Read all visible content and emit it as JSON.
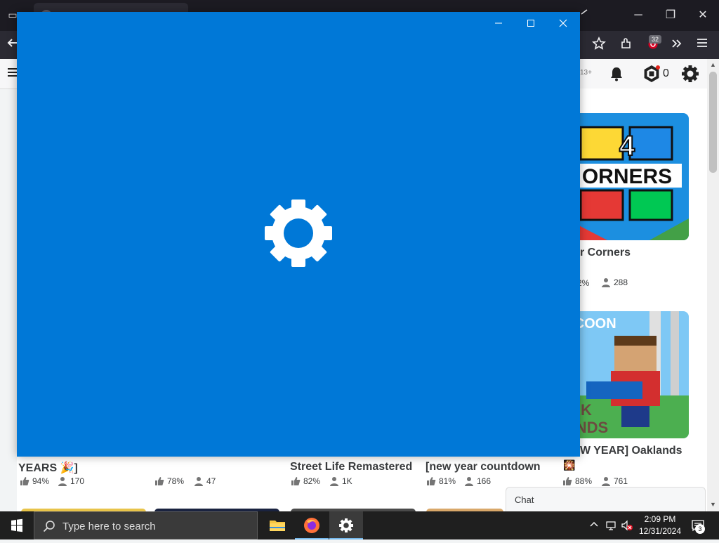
{
  "browser": {
    "tab_list_glyph": "▭",
    "window_controls": [
      "─",
      "❐",
      "✕"
    ],
    "nav_icons": [
      "star-icon",
      "extensions-icon",
      "pocket-icon",
      "overflow-icon",
      "menu-icon"
    ],
    "extension_badge": "32"
  },
  "roblox": {
    "age_label": "13+",
    "robux_count": "0",
    "games": [
      {
        "title": "r Corners",
        "rating": "2%",
        "players": "288"
      },
      {
        "title": "W YEAR] Oaklands",
        "title_emoji": "🎇",
        "rating": "88%",
        "players": "761"
      },
      {
        "title": "YEARS 🎉]",
        "rating": "94%",
        "players": "170"
      },
      {
        "title": "",
        "rating": "78%",
        "players": "47"
      },
      {
        "title": "Street Life Remastered",
        "rating": "82%",
        "players": "1K"
      },
      {
        "title": "[new year countdown",
        "rating": "81%",
        "players": "166"
      }
    ],
    "thumbnail_texts": {
      "corners_number": "4",
      "corners_word": "ORNERS",
      "oaklands_top": "YCOON",
      "oaklands_bottom_1": "AK",
      "oaklands_bottom_2": "ANDS"
    },
    "chat_label": "Chat"
  },
  "splash": {
    "controls": [
      "minimize",
      "maximize",
      "close"
    ],
    "icon": "gear-icon",
    "color": "#0078d7"
  },
  "taskbar": {
    "search_placeholder": "Type here to search",
    "apps": [
      "file-explorer-icon",
      "firefox-icon",
      "settings-icon"
    ],
    "time": "2:09 PM",
    "date": "12/31/2024",
    "notification_count": "3"
  }
}
